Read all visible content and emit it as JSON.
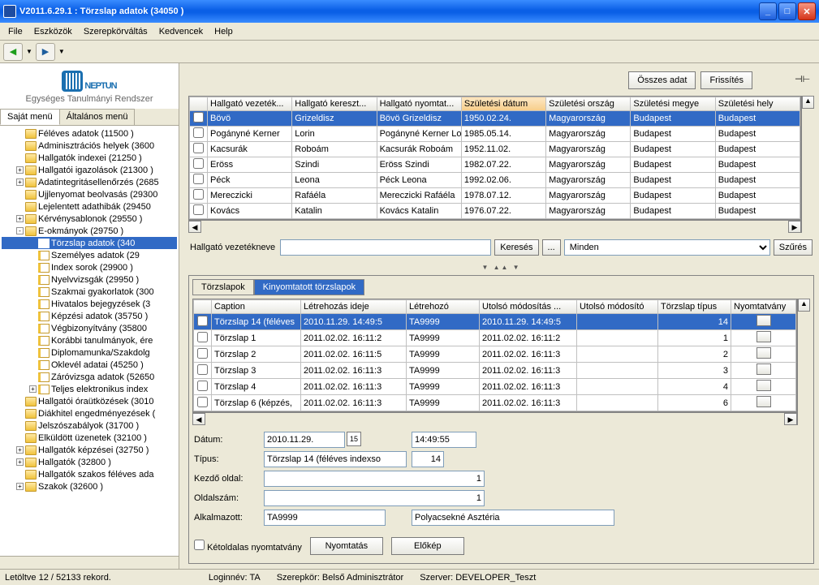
{
  "titlebar": {
    "title": "V2011.6.29.1 : Törzslap adatok (34050  )"
  },
  "menu": [
    "File",
    "Eszközök",
    "Szerepkörváltás",
    "Kedvencek",
    "Help"
  ],
  "logo": {
    "brand": "NEPTUN",
    "sub": "Egységes Tanulmányi Rendszer"
  },
  "left_tabs": [
    "Saját menü",
    "Általános menü"
  ],
  "tree": [
    {
      "lvl": 1,
      "exp": "",
      "ico": "folder",
      "label": "Féléves adatok (11500  )"
    },
    {
      "lvl": 1,
      "exp": "",
      "ico": "folder",
      "label": "Adminisztrációs helyek (3600"
    },
    {
      "lvl": 1,
      "exp": "",
      "ico": "folder",
      "label": "Hallgatók indexei (21250  )"
    },
    {
      "lvl": 1,
      "exp": "+",
      "ico": "folder",
      "label": "Hallgatói igazolások (21300  )"
    },
    {
      "lvl": 1,
      "exp": "+",
      "ico": "folder",
      "label": "Adatintegritásellenőrzés (2685"
    },
    {
      "lvl": 1,
      "exp": "",
      "ico": "folder",
      "label": "Ujjlenyomat beolvasás (29300"
    },
    {
      "lvl": 1,
      "exp": "",
      "ico": "folder",
      "label": "Lejelentett adathibák (29450"
    },
    {
      "lvl": 1,
      "exp": "+",
      "ico": "folder",
      "label": "Kérvénysablonok (29550  )"
    },
    {
      "lvl": 1,
      "exp": "-",
      "ico": "folder",
      "label": "E-okmányok (29750  )"
    },
    {
      "lvl": 2,
      "exp": "",
      "ico": "page",
      "label": "Törzslap adatok (340",
      "selected": true
    },
    {
      "lvl": 2,
      "exp": "",
      "ico": "page",
      "label": "Személyes adatok (29"
    },
    {
      "lvl": 2,
      "exp": "",
      "ico": "page",
      "label": "Index sorok (29900  )"
    },
    {
      "lvl": 2,
      "exp": "",
      "ico": "page",
      "label": "Nyelvvizsgák (29950  )"
    },
    {
      "lvl": 2,
      "exp": "",
      "ico": "page",
      "label": "Szakmai gyakorlatok (300"
    },
    {
      "lvl": 2,
      "exp": "",
      "ico": "page",
      "label": "Hivatalos bejegyzések (3"
    },
    {
      "lvl": 2,
      "exp": "",
      "ico": "page",
      "label": "Képzési adatok (35750  )"
    },
    {
      "lvl": 2,
      "exp": "",
      "ico": "page",
      "label": "Végbizonyítvány (35800"
    },
    {
      "lvl": 2,
      "exp": "",
      "ico": "page",
      "label": "Korábbi tanulmányok, ére"
    },
    {
      "lvl": 2,
      "exp": "",
      "ico": "page",
      "label": "Diplomamunka/Szakdolg"
    },
    {
      "lvl": 2,
      "exp": "",
      "ico": "page",
      "label": "Oklevél adatai (45250  )"
    },
    {
      "lvl": 2,
      "exp": "",
      "ico": "page",
      "label": "Záróvizsga adatok (52650"
    },
    {
      "lvl": 2,
      "exp": "+",
      "ico": "page",
      "label": "Teljes elektronikus index"
    },
    {
      "lvl": 1,
      "exp": "",
      "ico": "folder",
      "label": "Hallgatói óraütközések (3010"
    },
    {
      "lvl": 1,
      "exp": "",
      "ico": "folder",
      "label": "Diákhitel engedményezések ("
    },
    {
      "lvl": 1,
      "exp": "",
      "ico": "folder",
      "label": "Jelszószabályok (31700  )"
    },
    {
      "lvl": 1,
      "exp": "",
      "ico": "folder",
      "label": "Elküldött üzenetek (32100  )"
    },
    {
      "lvl": 1,
      "exp": "+",
      "ico": "folder",
      "label": "Hallgatók képzései (32750  )"
    },
    {
      "lvl": 1,
      "exp": "+",
      "ico": "folder",
      "label": "Hallgatók (32800  )"
    },
    {
      "lvl": 1,
      "exp": "",
      "ico": "folder",
      "label": "Hallgatók szakos féléves ada"
    },
    {
      "lvl": 1,
      "exp": "+",
      "ico": "folder",
      "label": "Szakok (32600  )"
    }
  ],
  "topbuttons": {
    "all": "Összes adat",
    "refresh": "Frissítés"
  },
  "grid1": {
    "cols": [
      "",
      "Hallgató vezeték...",
      "Hallgató kereszt...",
      "Hallgató nyomtat...",
      "Születési dátum",
      "Születési ország",
      "Születési megye",
      "Születési hely"
    ],
    "sortedCol": 4,
    "rows": [
      [
        "Bövö",
        "Grizeldisz",
        "Bövö Grizeldisz",
        "1950.02.24.",
        "Magyarország",
        "Budapest",
        "Budapest"
      ],
      [
        "Pogányné Kerner",
        "Lorin",
        "Pogányné Kerner Lo",
        "1985.05.14.",
        "Magyarország",
        "Budapest",
        "Budapest"
      ],
      [
        "Kacsurák",
        "Roboám",
        "Kacsurák Roboám",
        "1952.11.02.",
        "Magyarország",
        "Budapest",
        "Budapest"
      ],
      [
        "Eröss",
        "Szindi",
        "Eröss Szindi",
        "1982.07.22.",
        "Magyarország",
        "Budapest",
        "Budapest"
      ],
      [
        "Péck",
        "Leona",
        "Péck Leona",
        "1992.02.06.",
        "Magyarország",
        "Budapest",
        "Budapest"
      ],
      [
        "Mereczicki",
        "Rafáéla",
        "Mereczicki Rafáéla",
        "1978.07.12.",
        "Magyarország",
        "Budapest",
        "Budapest"
      ],
      [
        "Kovács",
        "Katalin",
        "Kovács Katalin",
        "1976.07.22.",
        "Magyarország",
        "Budapest",
        "Budapest"
      ]
    ],
    "selectedRow": 0
  },
  "filter": {
    "label": "Hallgató vezetékneve",
    "value": "",
    "search": "Keresés",
    "dots": "...",
    "dropdown": "Minden",
    "filterbtn": "Szűrés"
  },
  "tabs2": [
    "Törzslapok",
    "Kinyomtatott törzslapok"
  ],
  "grid2": {
    "cols": [
      "",
      "Caption",
      "Létrehozás ideje",
      "Létrehozó",
      "Utolsó módosítás ...",
      "Utolsó módosító",
      "Törzslap típus",
      "Nyomtatvány"
    ],
    "rows": [
      [
        "Törzslap 14 (féléves",
        "2010.11.29. 14:49:5",
        "TA9999",
        "2010.11.29. 14:49:5",
        "",
        "14",
        ""
      ],
      [
        "Törzslap 1",
        "2011.02.02. 16:11:2",
        "TA9999",
        "2011.02.02. 16:11:2",
        "",
        "1",
        ""
      ],
      [
        "Törzslap 2",
        "2011.02.02. 16:11:5",
        "TA9999",
        "2011.02.02. 16:11:3",
        "",
        "2",
        ""
      ],
      [
        "Törzslap 3",
        "2011.02.02. 16:11:3",
        "TA9999",
        "2011.02.02. 16:11:3",
        "",
        "3",
        ""
      ],
      [
        "Törzslap 4",
        "2011.02.02. 16:11:3",
        "TA9999",
        "2011.02.02. 16:11:3",
        "",
        "4",
        ""
      ],
      [
        "Törzslap 6 (képzés,",
        "2011.02.02. 16:11:3",
        "TA9999",
        "2011.02.02. 16:11:3",
        "",
        "6",
        ""
      ]
    ],
    "selectedRow": 0
  },
  "form": {
    "datum_label": "Dátum:",
    "datum": "2010.11.29.",
    "time": "14:49:55",
    "tipus_label": "Típus:",
    "tipus": "Törzslap 14 (féléves indexso",
    "tipus_num": "14",
    "kezdo_label": "Kezdő oldal:",
    "kezdo": "1",
    "oldal_label": "Oldalszám:",
    "oldal": "1",
    "alk_label": "Alkalmazott:",
    "alk_code": "TA9999",
    "alk_name": "Polyacsekné Asztéria",
    "ketoldalas": "Kétoldalas nyomtatvány",
    "nyomtatas": "Nyomtatás",
    "elokep": "Előkép"
  },
  "status": {
    "records": "Letöltve 12 / 52133 rekord.",
    "login": "Loginnév: TA",
    "role": "Szerepkör: Belső Adminisztrátor",
    "server": "Szerver: DEVELOPER_Teszt"
  }
}
